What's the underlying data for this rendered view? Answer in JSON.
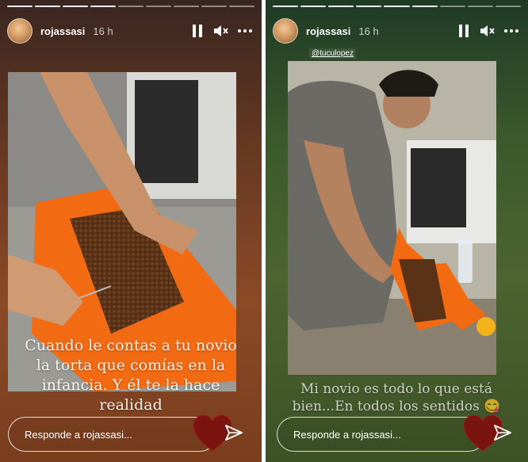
{
  "stories": [
    {
      "username": "rojassasi",
      "time": "16 h",
      "progress": {
        "segments": 9,
        "done": 4
      },
      "mention": "",
      "caption": "Cuando le contas a tu novio la torta que comías en la infancia. Y él te la hace realidad",
      "reply_placeholder": "Responde a rojassasi..."
    },
    {
      "username": "rojassasi",
      "time": "16 h",
      "progress": {
        "segments": 9,
        "done": 6
      },
      "mention": "@tuculopez",
      "caption": "Mi novio es todo lo que está bien...En todos los sentidos 😋",
      "reply_placeholder": "Responde a rojassasi..."
    }
  ],
  "icons": {
    "pause": "pause-icon",
    "mute": "volume-off-icon",
    "more": "more-icon",
    "heart": "heart-icon",
    "send": "send-icon"
  },
  "colors": {
    "heart": "#7a1410",
    "panel_left": "#7a3e1e",
    "panel_right": "#4c6430",
    "board": "#f06a10"
  }
}
